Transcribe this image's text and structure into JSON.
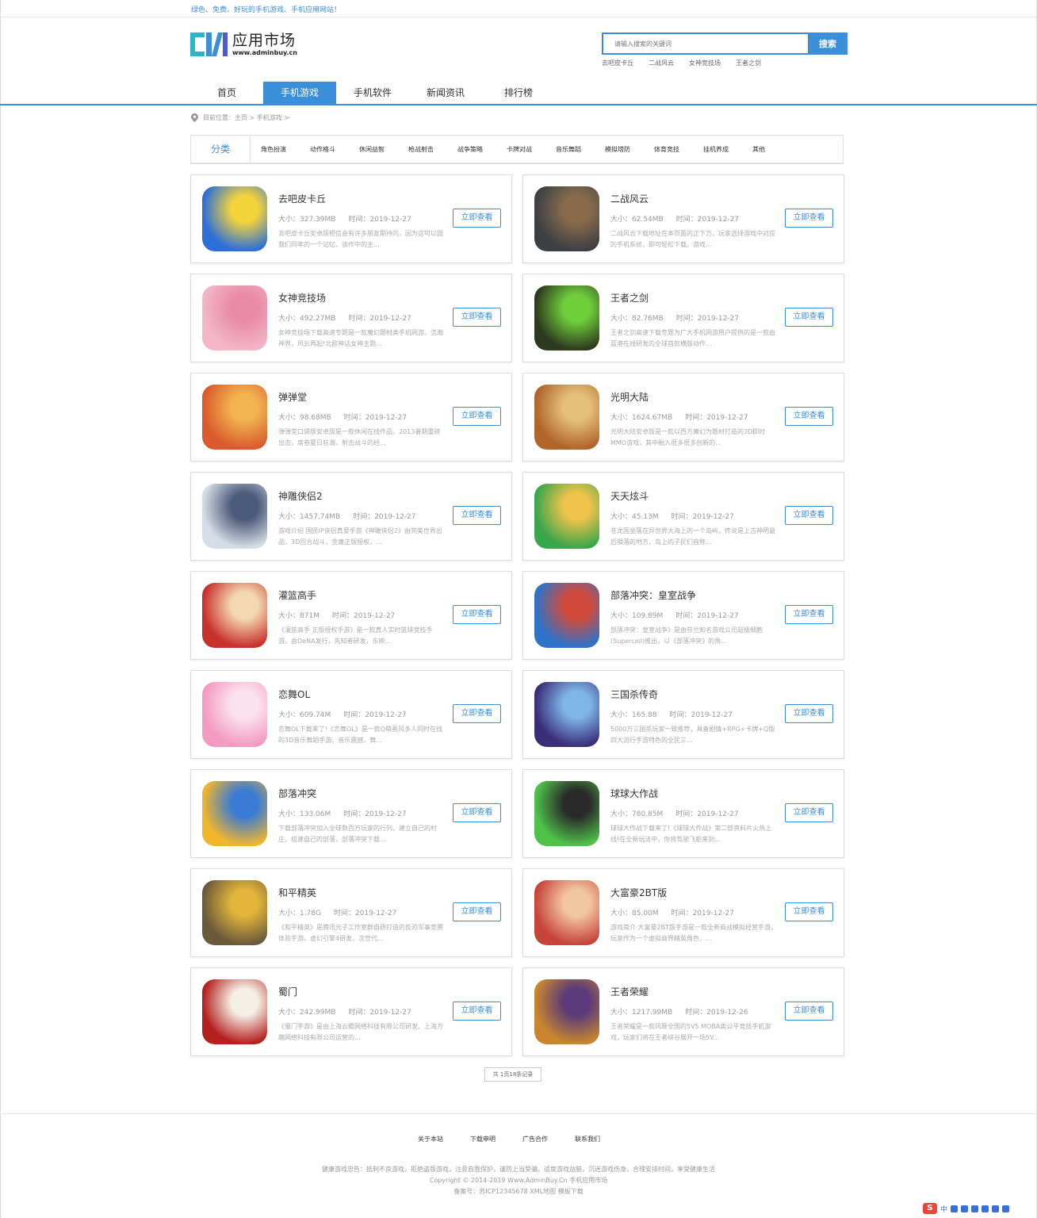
{
  "slogan": "绿色、免费、好玩的手机游戏、手机应用网站！",
  "logo": {
    "title": "应用市场",
    "url": "www.adminbuy.cn"
  },
  "search": {
    "placeholder": "请输入搜索的关键词",
    "button": "搜索"
  },
  "hotwords": [
    "去吧皮卡丘",
    "二战风云",
    "女神竞技场",
    "王者之剑"
  ],
  "nav": [
    "首页",
    "手机游戏",
    "手机软件",
    "新闻资讯",
    "排行榜"
  ],
  "nav_active": 1,
  "breadcrumb": "目前位置：主页 > 手机游戏 >",
  "categories": {
    "label": "分类",
    "items": [
      "角色扮演",
      "动作格斗",
      "休闲益智",
      "枪战射击",
      "战争策略",
      "卡牌对战",
      "音乐舞蹈",
      "模拟塔防",
      "体育竞技",
      "挂机养成",
      "其他"
    ]
  },
  "labels": {
    "size": "大小：",
    "time": "时间：",
    "button": "立即查看"
  },
  "apps": [
    {
      "name": "去吧皮卡丘",
      "size": "327.39MB",
      "time": "2019-12-27",
      "desc": "去吧皮卡丘安卓版相信会有许多朋友期待的，因为这可以圆我们同年的一个记忆，该作中的主...",
      "colors": [
        "#2d6fd6",
        "#f5d43a"
      ]
    },
    {
      "name": "二战风云",
      "size": "62.54MB",
      "time": "2019-12-27",
      "desc": "二战风云下载地址在本页面的正下方，玩家选择游戏中对应的手机系统，即可轻松下载。游戏...",
      "colors": [
        "#3c3f44",
        "#8a6b4c"
      ]
    },
    {
      "name": "女神竞技场",
      "size": "492.27MB",
      "time": "2019-12-27",
      "desc": "女神竞技场下载高速专题是一款魔幻题材类手机网游，浩瀚神界，风云再起!北欧神话女神主题...",
      "colors": [
        "#f4b6c9",
        "#e98aa6"
      ]
    },
    {
      "name": "王者之剑",
      "size": "82.76MB",
      "time": "2019-12-27",
      "desc": "王者之剑高速下载专题为广大手机网游用户提供的是一款由蓝港在线研发的全球首款横版动作...",
      "colors": [
        "#2e3a1e",
        "#6fcf3a"
      ]
    },
    {
      "name": "弹弹堂",
      "size": "98.68MB",
      "time": "2019-12-27",
      "desc": "弹弹堂口袋版安卓版是一款休闲在线作品，2013暑期重磅出击，席卷夏日狂潮，射击战斗的经...",
      "colors": [
        "#d95a2b",
        "#f2b350"
      ]
    },
    {
      "name": "光明大陆",
      "size": "1624.67MB",
      "time": "2019-12-27",
      "desc": "光明大陆安卓版是一款以西方魔幻为题材打造的3D即时MMO游戏，其中融入很多很多创新的...",
      "colors": [
        "#b0652a",
        "#e5c07b"
      ]
    },
    {
      "name": "神雕侠侣2",
      "size": "1457.74MB",
      "time": "2019-12-27",
      "desc": "游戏介绍 国民IP侠侣真爱手游《神雕侠侣2》由完美世界出品，3D回合战斗，金庸正版授权，...",
      "colors": [
        "#d7dde6",
        "#4a5a7a"
      ]
    },
    {
      "name": "天天炫斗",
      "size": "45.13M",
      "time": "2019-12-27",
      "desc": "苍龙国坐落在异世界大海上的一个岛屿，传说是上古神明最后隕落的地方，岛上的子民们自称...",
      "colors": [
        "#3aa64a",
        "#f0c34a"
      ]
    },
    {
      "name": "灌篮高手",
      "size": "871M",
      "time": "2019-12-27",
      "desc": "《灌篮高手 正版授权手游》是一款真人实时篮球竞技手游，由DeNA发行，先知者研发，东映...",
      "colors": [
        "#c8302c",
        "#f4d9b0"
      ]
    },
    {
      "name": "部落冲突：皇室战争",
      "size": "109.89M",
      "time": "2019-12-27",
      "desc": "部落冲突：皇室战争》是由芬兰知名游戏公司超级细胞(Supercell)推出，以《部落冲突》的角...",
      "colors": [
        "#2d73c9",
        "#d24a3c"
      ]
    },
    {
      "name": "恋舞OL",
      "size": "609.74M",
      "time": "2019-12-27",
      "desc": "恋舞OL下载来了!《恋舞OL》是一款Q萌画风多人同时在线的3D音乐舞蹈手游。音乐震撼，舞...",
      "colors": [
        "#f39ac0",
        "#fbe3ee"
      ]
    },
    {
      "name": "三国杀传奇",
      "size": "165.88",
      "time": "2019-12-27",
      "desc": "5000万三国杀玩家一致推荐，具备剧情+RPG+卡牌+Q版四大流行手游特色的全民三...",
      "colors": [
        "#3a2e78",
        "#7fb6e8"
      ]
    },
    {
      "name": "部落冲突",
      "size": "133.06M",
      "time": "2019-12-27",
      "desc": "下载部落冲突加入全球数百万玩家的行列，建立自己的村庄，组建自己的部落，部落冲突下载...",
      "colors": [
        "#f0b62e",
        "#3a7bd5"
      ]
    },
    {
      "name": "球球大作战",
      "size": "780.85M",
      "time": "2019-12-27",
      "desc": "球球大作战下载来了!《球球大作战》第二部资料片火热上线!在全新玩法中，你将驾驶飞船来到...",
      "colors": [
        "#4fc24a",
        "#2a2a2a"
      ]
    },
    {
      "name": "和平精英",
      "size": "1.78G",
      "time": "2019-12-27",
      "desc": "《和平精英》是腾讯光子工作室群自研打造的反恐军事竞赛体验手游。虚幻引擎4研发，次世代...",
      "colors": [
        "#6b5a3a",
        "#e3b53a"
      ]
    },
    {
      "name": "大富豪2BT版",
      "size": "85.00M",
      "time": "2019-12-27",
      "desc": "游戏简介 大富豪2BT版手游是一款全新商战模拟经营手游，玩家作为一个虚拟商界精英角色，...",
      "colors": [
        "#c6443a",
        "#f2c6a0"
      ]
    },
    {
      "name": "蜀门",
      "size": "242.99MB",
      "time": "2019-12-27",
      "desc": "《蜀门手游》是由上海云蟾网络科技有限公司研发、上海方趣网络科技有限公司运营的...",
      "colors": [
        "#b3201e",
        "#f5f0e6"
      ]
    },
    {
      "name": "王者荣耀",
      "size": "1217.99MB",
      "time": "2019-12-26",
      "desc": "王者荣耀是一款风靡全国的5V5 MOBA类公平竞技手机游戏，玩家们将在王者峡谷展开一场5V...",
      "colors": [
        "#c9862e",
        "#5a3a7a"
      ]
    }
  ],
  "pager": "共 1页18条记录",
  "footer": {
    "links": [
      "关于本站",
      "下载申明",
      "广告合作",
      "联系我们"
    ],
    "notice": "健康游戏忠告：抵制不良游戏，拒绝盗版游戏，注意自我保护，谨防上当受骗，适度游戏益脑，沉迷游戏伤身，合理安排时间，享受健康生活",
    "copyright": "Copyright © 2014-2019 Www.AdminBuy.Cn 手机应用市场",
    "icp": "备案号：苏ICP12345678 XML地图 模板下载"
  },
  "ime": {
    "logo": "S",
    "lang": "中"
  },
  "colors": {
    "accent": "#3b8ed8"
  }
}
